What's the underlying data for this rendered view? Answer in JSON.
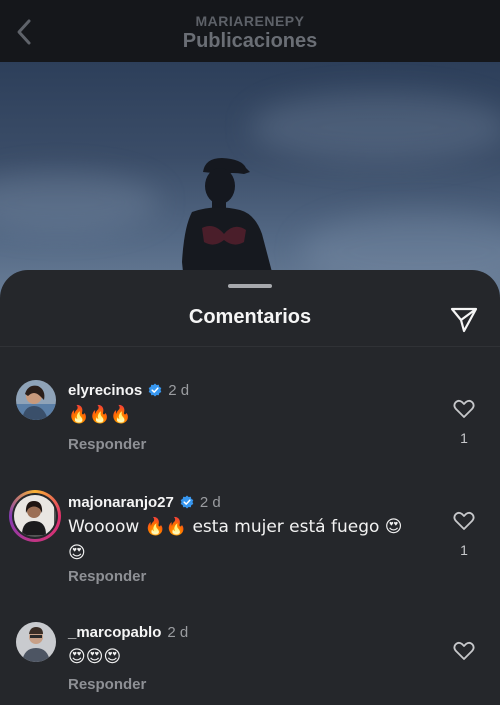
{
  "header": {
    "account": "MARIARENEPY",
    "title": "Publicaciones"
  },
  "sheet": {
    "title": "Comentarios"
  },
  "comments": [
    {
      "username": "elyrecinos",
      "verified": true,
      "time": "2 d",
      "text": "🔥🔥🔥",
      "reply_label": "Responder",
      "likes": "1"
    },
    {
      "username": "majonaranjo27",
      "verified": true,
      "time": "2 d",
      "text_line1": "Woooow 🔥🔥 esta mujer está fuego 😍",
      "text_line2": "😍",
      "reply_label": "Responder",
      "likes": "1"
    },
    {
      "username": "_marcopablo",
      "verified": false,
      "time": "2 d",
      "text": "😍😍😍",
      "reply_label": "Responder",
      "likes": ""
    }
  ],
  "colors": {
    "verified": "#3797f0",
    "background": "#25272b"
  }
}
